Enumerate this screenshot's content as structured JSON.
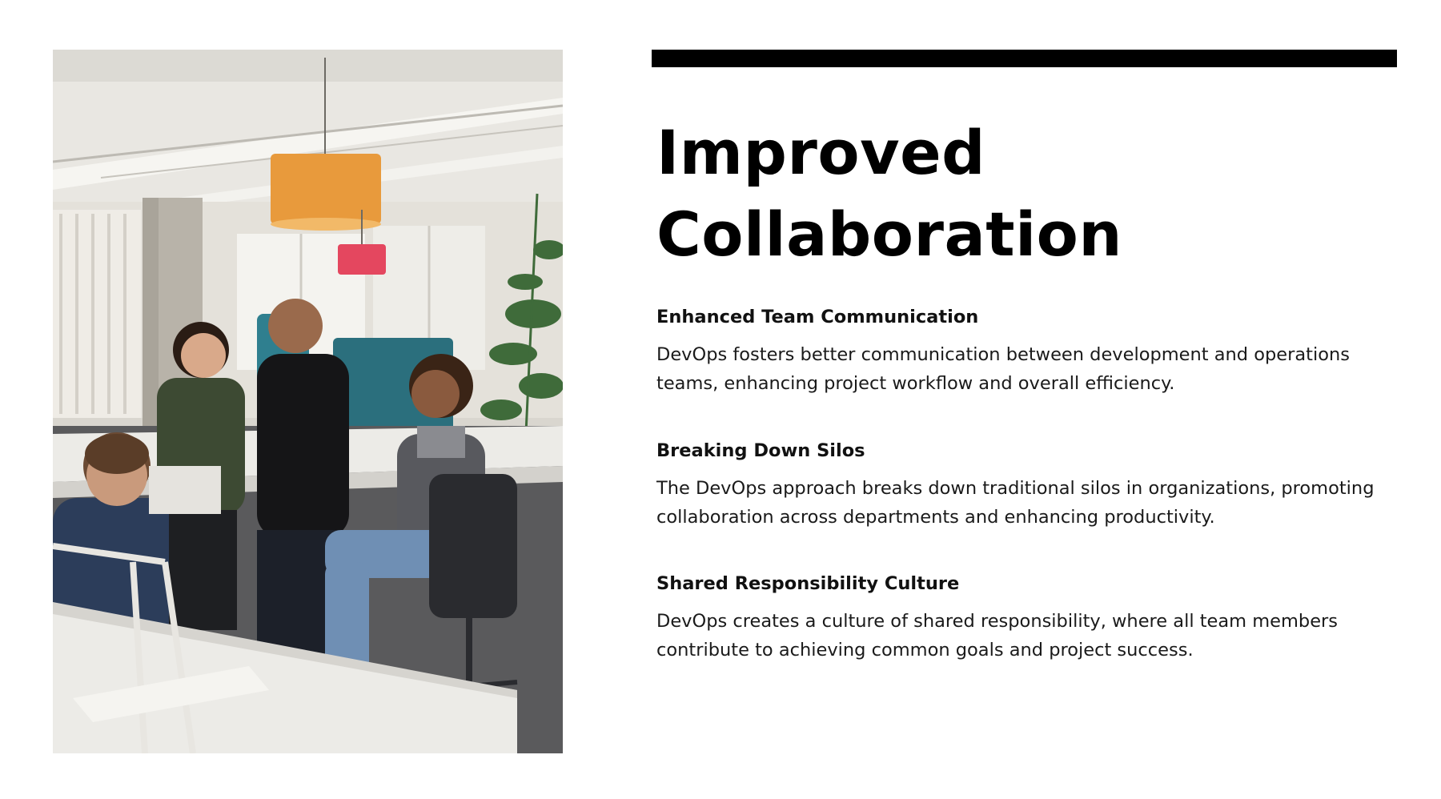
{
  "slide": {
    "title_line1": "Improved",
    "title_line2": "Collaboration",
    "sections": [
      {
        "heading": "Enhanced Team Communication",
        "body": "DevOps fosters better communication between development and operations teams, enhancing project workflow and overall efficiency."
      },
      {
        "heading": "Breaking Down Silos",
        "body": "The DevOps approach breaks down traditional silos in organizations, promoting collaboration across departments and enhancing productivity."
      },
      {
        "heading": "Shared Responsibility Culture",
        "body": "DevOps creates a culture of shared responsibility, where all team members contribute to achieving common goals and project success."
      }
    ]
  },
  "colors": {
    "rule": "#000000",
    "text": "#111111",
    "lamp_orange": "#e89a3c",
    "lamp_pink": "#e4475f",
    "panel_teal": "#2f7f8f"
  }
}
